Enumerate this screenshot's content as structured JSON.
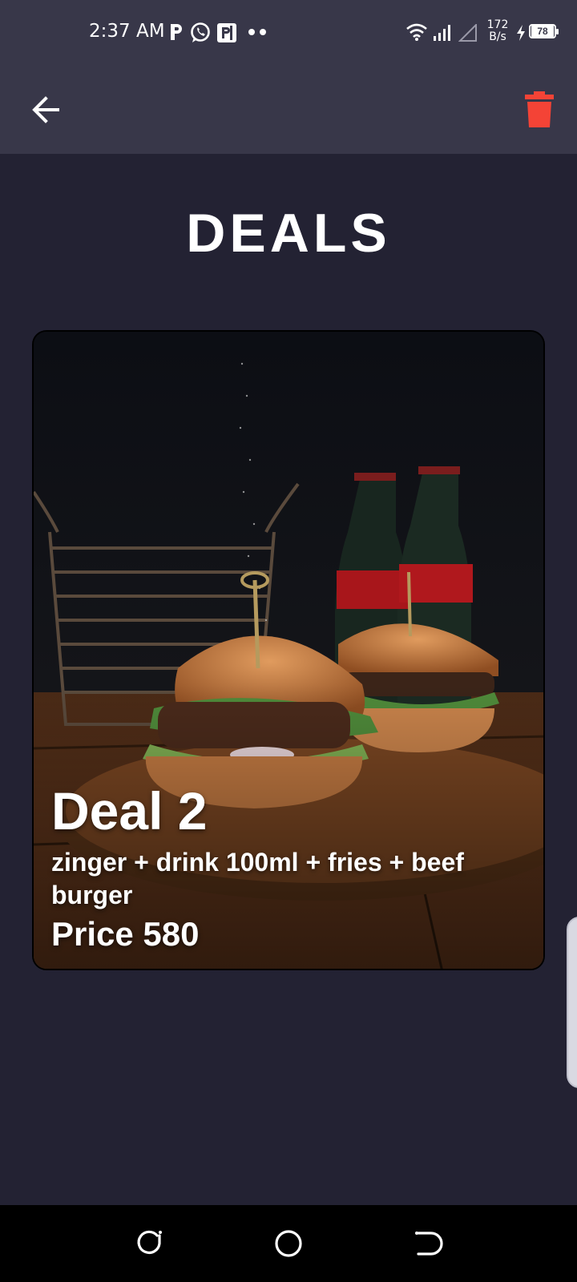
{
  "status_bar": {
    "time": "2:37 AM",
    "net_speed_value": "172",
    "net_speed_unit": "B/s",
    "battery": "78",
    "icons": [
      "p-icon",
      "whatsapp-icon",
      "parking-app-icon",
      "more-dots-icon",
      "wifi-icon",
      "signal-icon",
      "signal-empty-icon",
      "charging-icon",
      "battery-icon"
    ]
  },
  "app_bar": {
    "back_icon": "arrow-left-icon",
    "delete_icon": "trash-icon",
    "delete_color": "#f44336"
  },
  "page": {
    "title": "DEALS"
  },
  "deals": [
    {
      "name": "Deal 2",
      "items": "zinger + drink 100ml + fries + beef burger",
      "price": "Price 580"
    }
  ],
  "nav_bar": {
    "buttons": [
      "recents-icon",
      "home-icon",
      "back-icon"
    ]
  }
}
